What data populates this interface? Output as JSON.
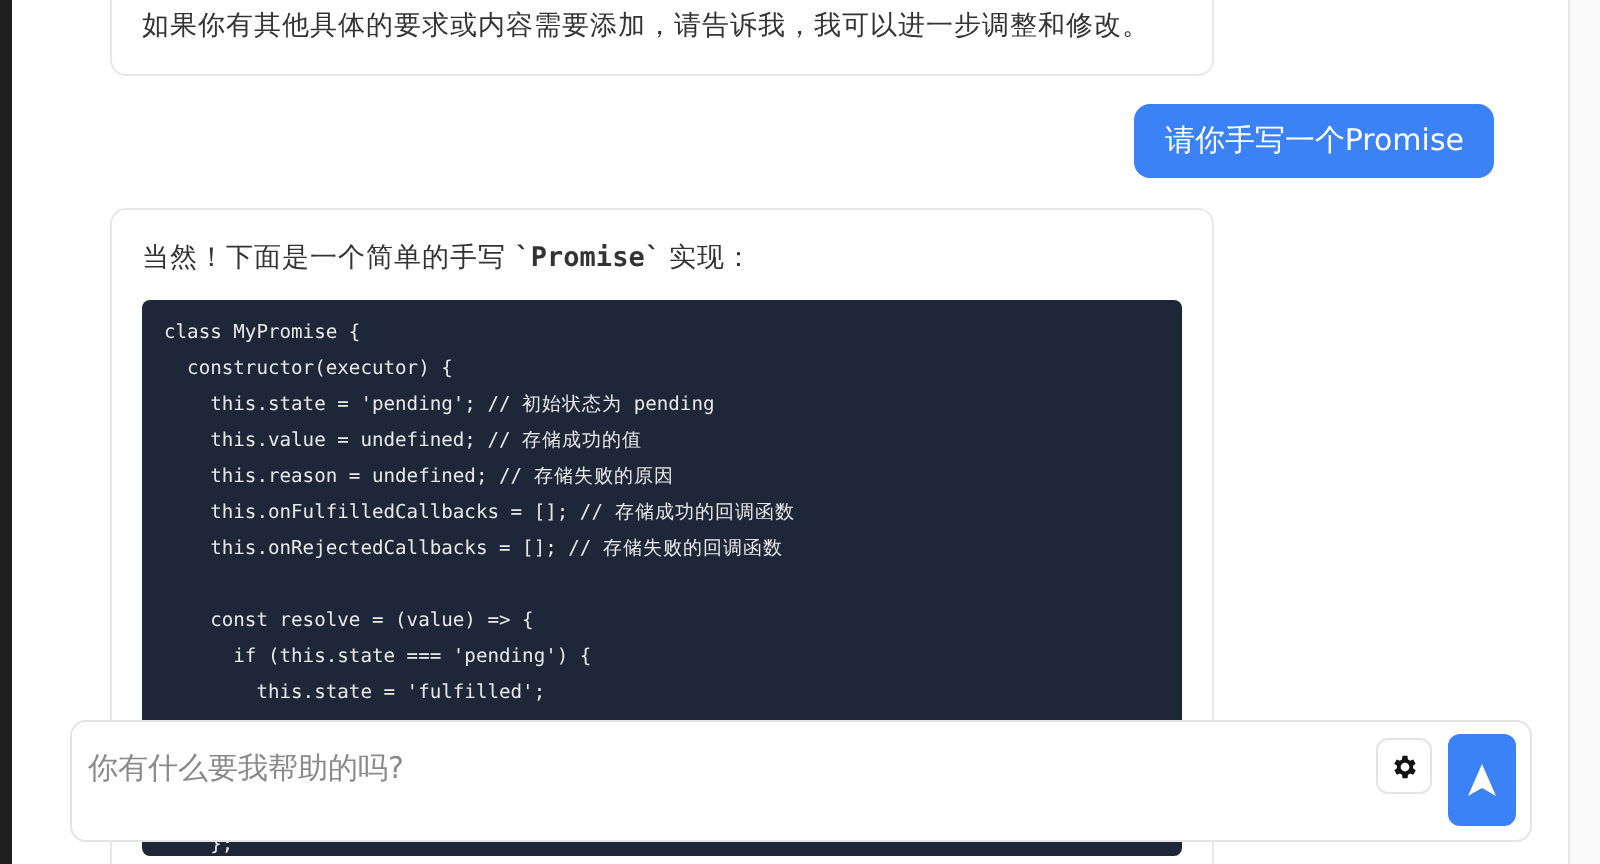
{
  "messages": [
    {
      "kind": "assistant_text",
      "text": "如果你有其他具体的要求或内容需要添加，请告诉我，我可以进一步调整和修改。"
    },
    {
      "kind": "user_bubble",
      "text": "请你手写一个Promise"
    },
    {
      "kind": "assistant_code",
      "text": "当然！下面是一个简单的手写 **`Promise`** 实现：",
      "code_lines": [
        {
          "kind": "code",
          "text": "class MyPromise {"
        },
        {
          "kind": "code",
          "text": "  constructor(executor) {"
        },
        {
          "kind": "code",
          "text": "    this.state = 'pending'; // 初始状态为 pending"
        },
        {
          "kind": "code",
          "text": "    this.value = undefined; // 存储成功的值"
        },
        {
          "kind": "code",
          "text": "    this.reason = undefined; // 存储失败的原因"
        },
        {
          "kind": "code",
          "text": "    this.onFulfilledCallbacks = []; // 存储成功的回调函数"
        },
        {
          "kind": "code",
          "text": "    this.onRejectedCallbacks = []; // 存储失败的回调函数"
        },
        {
          "kind": "blank"
        },
        {
          "kind": "code",
          "text": "    const resolve = (value) => {"
        },
        {
          "kind": "code",
          "text": "      if (this.state === 'pending') {"
        },
        {
          "kind": "code",
          "text": "        this.state = 'fulfilled';"
        }
      ],
      "code_lines_below_input": [
        {
          "kind": "code",
          "text": "    };"
        }
      ]
    }
  ],
  "composer": {
    "placeholder": "你有什么要我帮助的吗?"
  }
}
